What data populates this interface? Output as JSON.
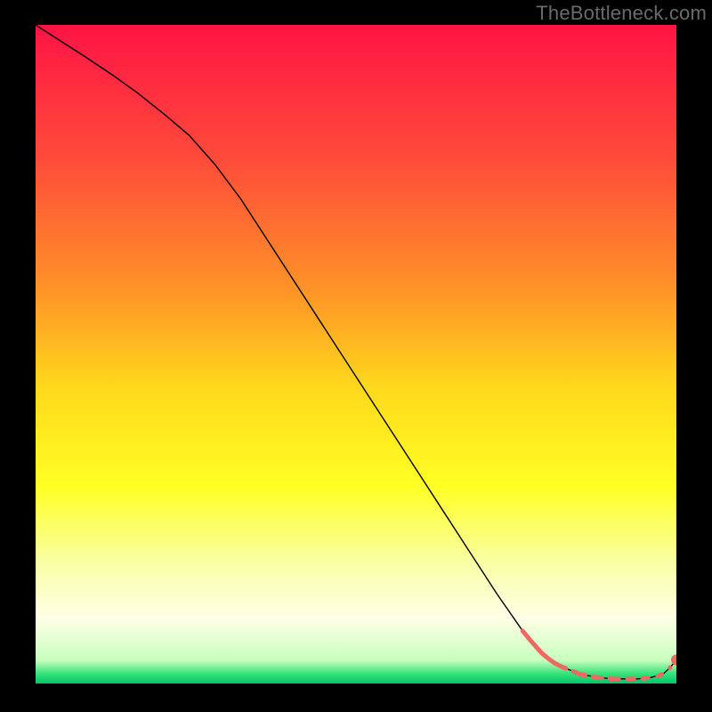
{
  "watermark": "TheBottleneck.com",
  "chart_data": {
    "type": "line",
    "title": "",
    "xlabel": "",
    "ylabel": "",
    "xlim": [
      0,
      100
    ],
    "ylim": [
      0,
      100
    ],
    "grid": false,
    "legend": false,
    "background_gradient": {
      "stops": [
        {
          "offset": 0.0,
          "color": "#ff1445"
        },
        {
          "offset": 0.2,
          "color": "#ff4a3b"
        },
        {
          "offset": 0.4,
          "color": "#ff9228"
        },
        {
          "offset": 0.55,
          "color": "#ffd81c"
        },
        {
          "offset": 0.7,
          "color": "#ffff25"
        },
        {
          "offset": 0.82,
          "color": "#f8ffa8"
        },
        {
          "offset": 0.9,
          "color": "#ffffe6"
        },
        {
          "offset": 0.965,
          "color": "#c8ffbf"
        },
        {
          "offset": 0.985,
          "color": "#36e27a"
        },
        {
          "offset": 1.0,
          "color": "#06c46a"
        }
      ]
    },
    "series": [
      {
        "name": "curve",
        "style": "solid",
        "color": "#000000",
        "width": 1.4,
        "x": [
          0,
          4,
          8,
          12,
          16,
          20,
          24,
          28,
          32,
          36,
          40,
          44,
          48,
          52,
          56,
          60,
          64,
          68,
          72,
          76,
          79,
          82,
          85,
          88,
          90,
          92,
          94,
          96,
          98,
          99,
          100
        ],
        "y": [
          100,
          97.5,
          95,
          92.4,
          89.6,
          86.5,
          83.2,
          78.8,
          73.6,
          67.6,
          61.6,
          55.6,
          49.6,
          43.6,
          37.6,
          31.6,
          25.6,
          19.6,
          13.6,
          8.0,
          4.6,
          2.6,
          1.4,
          0.9,
          0.7,
          0.7,
          0.7,
          0.9,
          1.5,
          2.4,
          3.6
        ]
      },
      {
        "name": "highlight-dashes",
        "style": "dash-dots",
        "color": "#ec6a62",
        "width": 5,
        "x": [
          76.0,
          77.0,
          78.0,
          79.0,
          80.0,
          81.0,
          82.0,
          83.0,
          84.0,
          85.0,
          86.0,
          87.0,
          88.0,
          89.0,
          90.0,
          91.0,
          92.0,
          93.0,
          94.0,
          95.0,
          96.0,
          97.0,
          98.0,
          99.0
        ],
        "y": [
          8.0,
          6.8,
          5.7,
          4.6,
          3.8,
          3.1,
          2.6,
          2.2,
          1.8,
          1.4,
          1.2,
          1.0,
          0.9,
          0.8,
          0.7,
          0.7,
          0.7,
          0.7,
          0.7,
          0.8,
          0.9,
          1.1,
          1.5,
          2.4
        ]
      }
    ],
    "markers": [
      {
        "x": 100,
        "y": 3.6,
        "r": 6,
        "color": "#ec6a62"
      }
    ]
  }
}
